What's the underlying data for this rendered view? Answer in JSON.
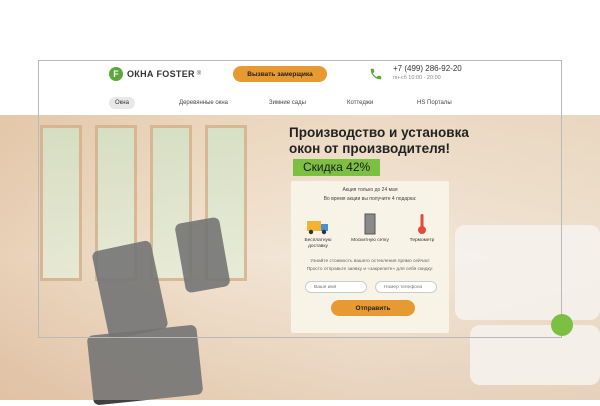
{
  "header": {
    "brand": "ОКНА FOSTER",
    "brand_mark": "F",
    "brand_reg": "®",
    "callback_label": "Вызвать замерщика",
    "phone": "+7 (499) 286-92-20",
    "hours": "пн-сб 10:00 - 20:00"
  },
  "nav": {
    "items": [
      {
        "label": "Окна",
        "active": true
      },
      {
        "label": "Деревянные окна",
        "active": false
      },
      {
        "label": "Зимние сады",
        "active": false
      },
      {
        "label": "Коттеджи",
        "active": false
      },
      {
        "label": "HS Порталы",
        "active": false
      }
    ]
  },
  "hero": {
    "headline": "Производство и установка окон от производителя!",
    "discount": "Скидка 42%"
  },
  "offer": {
    "line1": "Акция только до 24 мая",
    "line2": "Во время акции вы получите 4 подарка:",
    "gifts": [
      {
        "label": "Бесплатную доставку",
        "icon": "delivery-truck-icon"
      },
      {
        "label": "Москитную сетку",
        "icon": "mosquito-net-icon"
      },
      {
        "label": "Термометр",
        "icon": "thermometer-icon"
      }
    ],
    "note1": "Узнайте стоимость вашего остекления прямо сейчас!",
    "note2": "Просто отправьте заявку и «закрепите» для себя скидку:",
    "name_placeholder": "Ваше имя",
    "phone_placeholder": "Номер телефона",
    "submit_label": "Отправить"
  },
  "colors": {
    "accent": "#e79a32",
    "green": "#7bc043"
  }
}
